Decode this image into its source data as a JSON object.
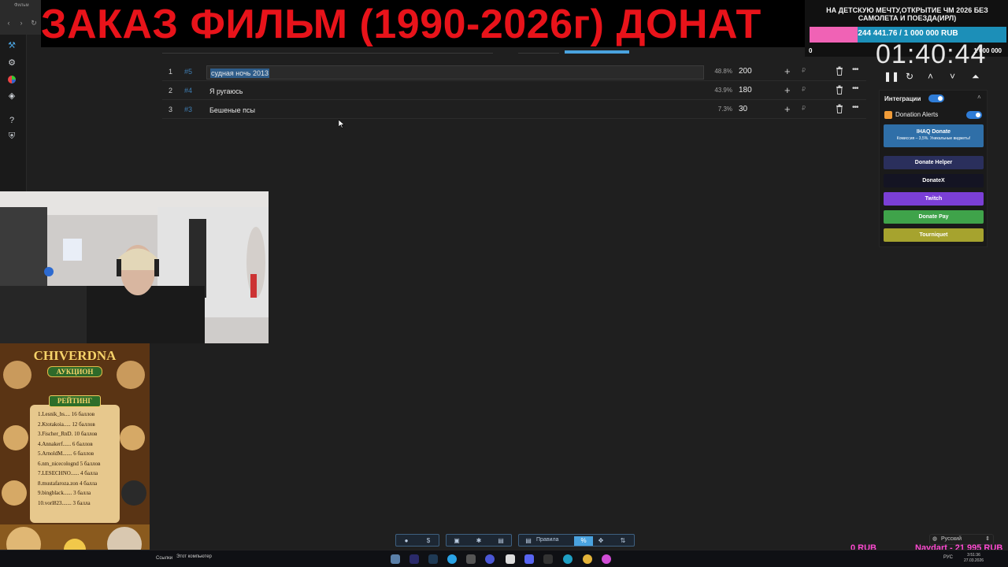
{
  "browser": {
    "tab_label": "Фильм"
  },
  "banner": {
    "text": "ЗАКАЗ ФИЛЬМ (1990-2026г) ДОНАТ"
  },
  "lots": [
    {
      "num": "1",
      "id": "#5",
      "name": "судная ночь 2013",
      "percent": "48.8%",
      "amount": "200",
      "currency": "₽",
      "selected": true
    },
    {
      "num": "2",
      "id": "#4",
      "name": "Я ругаюсь",
      "percent": "43.9%",
      "amount": "180",
      "currency": "₽",
      "selected": false
    },
    {
      "num": "3",
      "id": "#3",
      "name": "Бешеные псы",
      "percent": "7.3%",
      "amount": "30",
      "currency": "₽",
      "selected": false
    }
  ],
  "goal": {
    "title": "НА ДЕТСКУЮ МЕЧТУ,ОТКРЫТИЕ ЧМ 2026 БЕЗ САМОЛЕТА И ПОЕЗДА(ИРЛ)",
    "progress_text": "244 441.76 / 1 000 000 RUB",
    "progress_fraction": 0.244,
    "min": "0",
    "max": "1 000 000",
    "fill_color": "#f062b5",
    "track_color": "#1c8fb8"
  },
  "timer": {
    "value": "01:40:44"
  },
  "integrations": {
    "header": "Интеграции",
    "donation_alerts": "Donation Alerts",
    "buttons": [
      {
        "label": "IHAQ Donate",
        "sub": "Комиссия – 3,5%. Уникальные виджеты!",
        "color": "#2f6fa8"
      },
      {
        "label": "Donate Helper",
        "sub": "",
        "color": "#2a2f5c"
      },
      {
        "label": "DonateX",
        "sub": "",
        "color": "#141423"
      },
      {
        "label": "Twitch",
        "sub": "",
        "color": "#7b3fd6"
      },
      {
        "label": "Donate Pay",
        "sub": "",
        "color": "#3fa34a"
      },
      {
        "label": "Tourniquet",
        "sub": "",
        "color": "#a6a32e"
      }
    ]
  },
  "rating": {
    "title": "CHIVERDNA",
    "subtitle": "АУКЦИОН",
    "tag": "РЕЙТИНГ",
    "items": [
      "1.Lesnik_bs.... 16 баллов",
      "2.Ktotakoia..... 12 баллов",
      "3.Fischer_RnD. 10 баллов",
      "4.Annakerf...... 6 баллов",
      "5.ArnoldM....... 6 баллов",
      "6.nm_nicecolognd 5 баллов",
      "7.LESECHNO...... 4 балла",
      "8.mustafaroza.zon 4 балла",
      "9.bingblack...... 3 балла",
      "10.vorl823....... 3 балла"
    ]
  },
  "toolbar": {
    "rules_label": "Правила"
  },
  "language": {
    "label": "Русский"
  },
  "ticker": {
    "left": "0 RUB",
    "right": "Naydart - 21 995 RUB"
  },
  "taskbar": {
    "links": "Ссылки",
    "this_pc": "Этот компьютер",
    "tray_lang": "РУС",
    "time": "3:51:36",
    "date": "27.03.2026"
  }
}
